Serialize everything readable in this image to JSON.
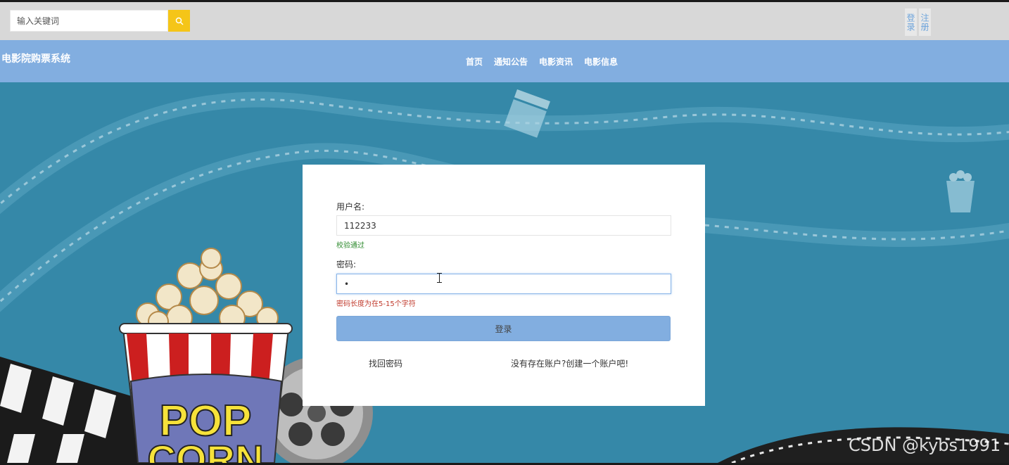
{
  "search": {
    "placeholder": "输入关键词",
    "icon": "search-icon"
  },
  "auth": {
    "login_label": "登录",
    "register_label": "注册"
  },
  "navbar": {
    "brand": "电影院购票系统",
    "items": [
      {
        "label": "首页"
      },
      {
        "label": "通知公告"
      },
      {
        "label": "电影资讯"
      },
      {
        "label": "电影信息"
      }
    ]
  },
  "login_form": {
    "username_label": "用户名:",
    "username_value": "112233",
    "username_hint": "校验通过",
    "password_label": "密码:",
    "password_value": "•",
    "password_hint": "密码长度为在5-15个字符",
    "submit_label": "登录",
    "forgot_link": "找回密码",
    "register_link": "没有存在账户?创建一个账户吧!"
  },
  "popcorn": {
    "text_line1": "POP",
    "text_line2": "CORN"
  },
  "watermark": "CSDN @kybs1991",
  "colors": {
    "topbar": "#d8d8d8",
    "navbar": "#82aee0",
    "hero": "#3588a8",
    "search_button": "#f5c518",
    "card": "#ffffff"
  }
}
